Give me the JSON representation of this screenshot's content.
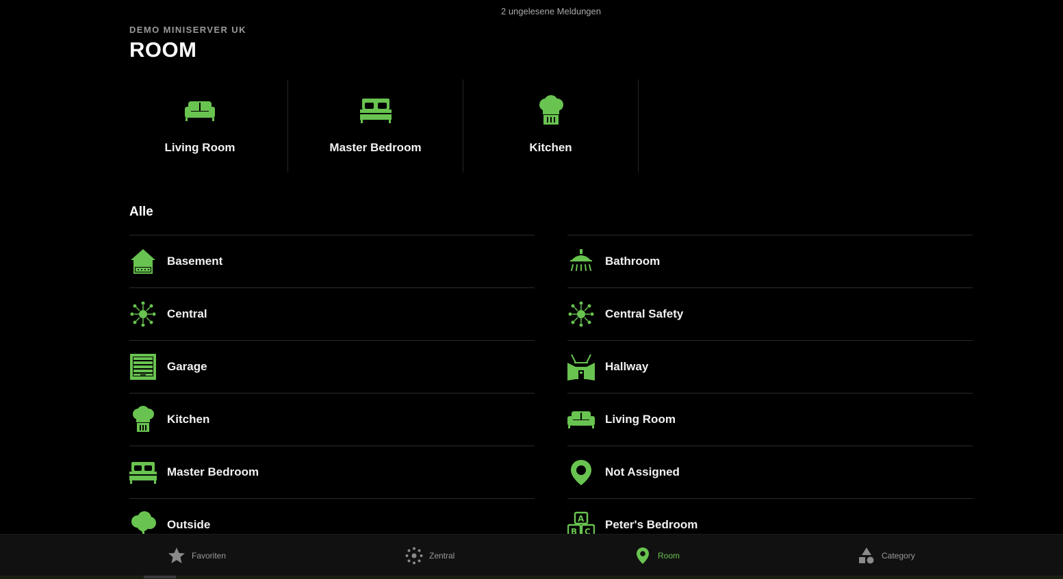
{
  "header": {
    "notifications": "2 ungelesene Meldungen",
    "server_name": "DEMO MINISERVER UK",
    "page_title": "ROOM"
  },
  "favorites": [
    {
      "label": "Living Room",
      "icon": "sofa-icon"
    },
    {
      "label": "Master Bedroom",
      "icon": "bed-icon"
    },
    {
      "label": "Kitchen",
      "icon": "chef-hat-icon"
    }
  ],
  "section_title": "Alle",
  "rooms_left": [
    {
      "label": "Basement",
      "icon": "house-icon"
    },
    {
      "label": "Central",
      "icon": "central-hub-icon"
    },
    {
      "label": "Garage",
      "icon": "garage-door-icon"
    },
    {
      "label": "Kitchen",
      "icon": "chef-hat-icon"
    },
    {
      "label": "Master Bedroom",
      "icon": "bed-icon"
    },
    {
      "label": "Outside",
      "icon": "tree-icon"
    }
  ],
  "rooms_right": [
    {
      "label": "Bathroom",
      "icon": "shower-icon"
    },
    {
      "label": "Central Safety",
      "icon": "central-hub-icon"
    },
    {
      "label": "Hallway",
      "icon": "hallway-icon"
    },
    {
      "label": "Living Room",
      "icon": "sofa-icon"
    },
    {
      "label": "Not Assigned",
      "icon": "location-pin-icon"
    },
    {
      "label": "Peter's Bedroom",
      "icon": "abc-blocks-icon"
    }
  ],
  "tabs": [
    {
      "label": "Favoriten",
      "icon": "star-icon",
      "active": false
    },
    {
      "label": "Zentral",
      "icon": "central-hub-icon",
      "active": false
    },
    {
      "label": "Room",
      "icon": "location-pin-icon",
      "active": true
    },
    {
      "label": "Category",
      "icon": "shapes-icon",
      "active": false
    }
  ],
  "colors": {
    "accent": "#69c350",
    "background": "#000000",
    "tabbar": "#111111",
    "divider": "#2b2b2b",
    "muted_text": "#9a9a9a"
  }
}
